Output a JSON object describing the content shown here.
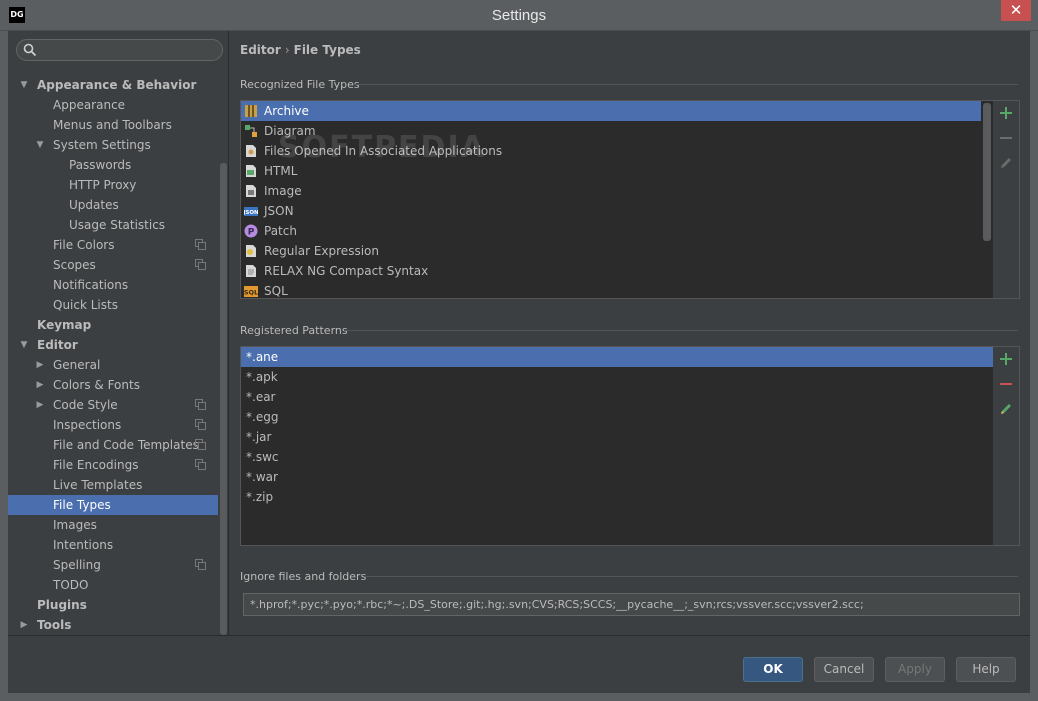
{
  "window": {
    "app_logo": "DG",
    "title": "Settings",
    "close_glyph": "✕"
  },
  "search": {
    "placeholder": ""
  },
  "sidebar": {
    "items": [
      {
        "label": "Appearance & Behavior",
        "level": 0,
        "bold": true,
        "arrow": "down"
      },
      {
        "label": "Appearance",
        "level": 1
      },
      {
        "label": "Menus and Toolbars",
        "level": 1
      },
      {
        "label": "System Settings",
        "level": 1,
        "arrow": "down"
      },
      {
        "label": "Passwords",
        "level": 2
      },
      {
        "label": "HTTP Proxy",
        "level": 2
      },
      {
        "label": "Updates",
        "level": 2
      },
      {
        "label": "Usage Statistics",
        "level": 2
      },
      {
        "label": "File Colors",
        "level": 1,
        "copy": true
      },
      {
        "label": "Scopes",
        "level": 1,
        "copy": true
      },
      {
        "label": "Notifications",
        "level": 1
      },
      {
        "label": "Quick Lists",
        "level": 1
      },
      {
        "label": "Keymap",
        "level": 0,
        "bold": true
      },
      {
        "label": "Editor",
        "level": 0,
        "bold": true,
        "arrow": "down"
      },
      {
        "label": "General",
        "level": 1,
        "arrow": "right"
      },
      {
        "label": "Colors & Fonts",
        "level": 1,
        "arrow": "right"
      },
      {
        "label": "Code Style",
        "level": 1,
        "arrow": "right",
        "copy": true
      },
      {
        "label": "Inspections",
        "level": 1,
        "copy": true
      },
      {
        "label": "File and Code Templates",
        "level": 1,
        "copy": true
      },
      {
        "label": "File Encodings",
        "level": 1,
        "copy": true
      },
      {
        "label": "Live Templates",
        "level": 1
      },
      {
        "label": "File Types",
        "level": 1,
        "selected": true
      },
      {
        "label": "Images",
        "level": 1
      },
      {
        "label": "Intentions",
        "level": 1
      },
      {
        "label": "Spelling",
        "level": 1,
        "copy": true
      },
      {
        "label": "TODO",
        "level": 1
      },
      {
        "label": "Plugins",
        "level": 0,
        "bold": true
      },
      {
        "label": "Tools",
        "level": 0,
        "bold": true,
        "arrow": "right"
      }
    ]
  },
  "breadcrumb": {
    "parent": "Editor",
    "separator": "›",
    "current": "File Types"
  },
  "recognized": {
    "label": "Recognized File Types",
    "items": [
      {
        "label": "Archive",
        "icon": "archive-icon",
        "selected": true
      },
      {
        "label": "Diagram",
        "icon": "diagram-icon"
      },
      {
        "label": "Files Opened In Associated Applications",
        "icon": "external-file-icon"
      },
      {
        "label": "HTML",
        "icon": "html-icon"
      },
      {
        "label": "Image",
        "icon": "image-icon"
      },
      {
        "label": "JSON",
        "icon": "json-icon"
      },
      {
        "label": "Patch",
        "icon": "patch-icon"
      },
      {
        "label": "Regular Expression",
        "icon": "regex-icon"
      },
      {
        "label": "RELAX NG Compact Syntax",
        "icon": "text-file-icon"
      },
      {
        "label": "SQL",
        "icon": "sql-icon"
      }
    ]
  },
  "patterns": {
    "label": "Registered Patterns",
    "items": [
      "*.ane",
      "*.apk",
      "*.ear",
      "*.egg",
      "*.jar",
      "*.swc",
      "*.war",
      "*.zip"
    ]
  },
  "ignore": {
    "label": "Ignore files and folders",
    "value": "*.hprof;*.pyc;*.pyo;*.rbc;*~;.DS_Store;.git;.hg;.svn;CVS;RCS;SCCS;__pycache__;_svn;rcs;vssver.scc;vssver2.scc;"
  },
  "buttons": {
    "ok": "OK",
    "cancel": "Cancel",
    "apply": "Apply",
    "help": "Help"
  },
  "watermark": "SOFTPEDIA",
  "colors": {
    "selection": "#4b6eaf",
    "add": "#59a869",
    "remove": "#c75450",
    "background": "#3c3f41",
    "list_bg": "#2b2b2b"
  }
}
